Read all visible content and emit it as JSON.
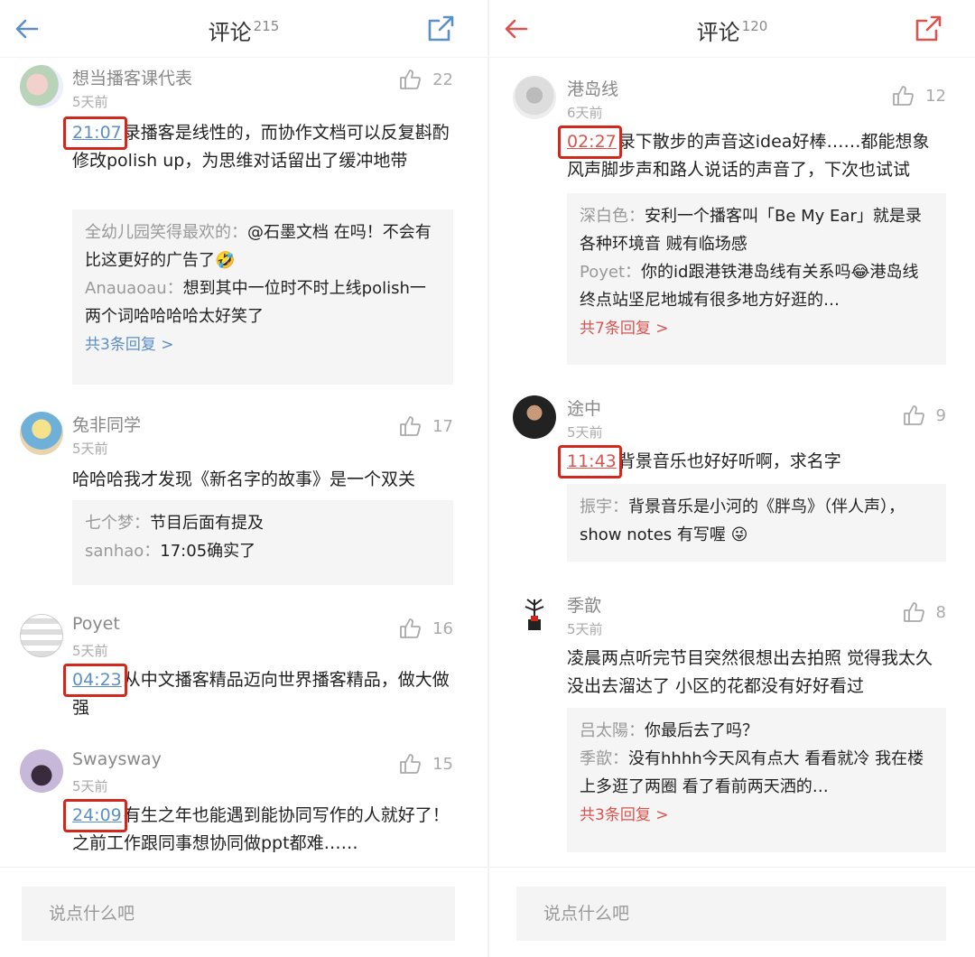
{
  "left": {
    "title": "评论",
    "count": "215",
    "accent": "#5b8fc7",
    "comments": [
      {
        "user": "想当播客课代表",
        "time": "5天前",
        "likes": "22",
        "timestamp": "21:07",
        "text": "录播客是线性的，而协作文档可以反复斟酌修改polish up，为思维对话留出了缓冲地带",
        "replies": [
          {
            "name": "全幼儿园笑得最欢的：",
            "text": "@石墨文档 在吗！不会有比这更好的广告了🤣"
          },
          {
            "name": "Anauaoau：",
            "text": "想到其中一位时不时上线polish一两个词哈哈哈哈太好笑了"
          }
        ],
        "more": "共3条回复 >"
      },
      {
        "user": "兔非同学",
        "time": "5天前",
        "likes": "17",
        "text": "哈哈哈我才发现《新名字的故事》是一个双关",
        "replies": [
          {
            "name": "七个梦：",
            "text": "节目后面有提及"
          },
          {
            "name": "sanhao：",
            "text": "17:05确实了"
          }
        ]
      },
      {
        "user": "Poyet",
        "time": "5天前",
        "likes": "16",
        "timestamp": "04:23",
        "text": "从中文播客精品迈向世界播客精品，做大做强"
      },
      {
        "user": "Swaysway",
        "time": "5天前",
        "likes": "15",
        "timestamp": "24:09",
        "text": "有生之年也能遇到能协同写作的人就好了！之前工作跟同事想协同做ppt都难……"
      }
    ],
    "input_placeholder": "说点什么吧"
  },
  "right": {
    "title": "评论",
    "count": "120",
    "accent": "#d9534f",
    "comments": [
      {
        "user": "港岛线",
        "time": "6天前",
        "likes": "12",
        "timestamp": "02:27",
        "text": "录下散步的声音这idea好棒……都能想象风声脚步声和路人说话的声音了，下次也试试",
        "replies": [
          {
            "name": "深白色：",
            "text": "安利一个播客叫「Be My Ear」就是录各种环境音 贼有临场感"
          },
          {
            "name": "Poyet：",
            "text": "你的id跟港铁港岛线有关系吗😂港岛线终点站坚尼地城有很多地方好逛的…"
          }
        ],
        "more": "共7条回复 >"
      },
      {
        "user": "途中",
        "time": "5天前",
        "likes": "9",
        "timestamp": "11:43",
        "text": "背景音乐也好好听啊，求名字",
        "replies": [
          {
            "name": "振宇：",
            "text": "背景音乐是小河的《胖鸟》（伴人声），show notes 有写喔 😜"
          }
        ]
      },
      {
        "user": "季歆",
        "time": "5天前",
        "likes": "8",
        "text": "凌晨两点听完节目突然很想出去拍照 觉得我太久没出去溜达了 小区的花都没有好好看过",
        "replies": [
          {
            "name": "吕太陽：",
            "text": "你最后去了吗？"
          },
          {
            "name": "季歆：",
            "text": "没有hhhh今天风有点大 看看就冷 我在楼上多逛了两圈 看了看前两天洒的…"
          }
        ],
        "more": "共3条回复 >"
      }
    ],
    "input_placeholder": "说点什么吧"
  },
  "icons": {
    "back": "back-arrow-icon",
    "share": "share-icon",
    "like": "thumbs-up-icon"
  }
}
